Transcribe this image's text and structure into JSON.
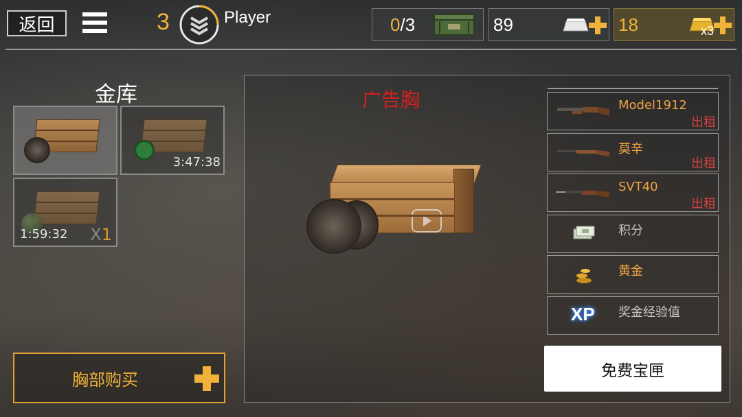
{
  "header": {
    "back_label": "返回",
    "level": "3",
    "player_name": "Player",
    "crates_count_current": "0",
    "crates_count_total": "/3",
    "silver": "89",
    "gold": "18",
    "gold_multiplier": "x3"
  },
  "vault": {
    "title": "金库",
    "slots": [
      {
        "timer": ""
      },
      {
        "timer": "3:47:38"
      },
      {
        "timer": "1:59:32",
        "count_prefix": "X",
        "count": "1"
      }
    ],
    "buy_label": "胸部购买"
  },
  "chest": {
    "name": "广告胸",
    "rewards": [
      {
        "label": "Model1912",
        "tag": "出租",
        "icon": "shotgun-icon"
      },
      {
        "label": "莫辛",
        "tag": "出租",
        "icon": "rifle-icon"
      },
      {
        "label": "SVT40",
        "tag": "出租",
        "icon": "rifle-bayonet-icon"
      },
      {
        "label": "积分",
        "icon": "cash-stack-icon"
      },
      {
        "label": "黄金",
        "icon": "gold-coins-icon"
      },
      {
        "label": "奖金经验值",
        "icon": "xp-icon",
        "icon_text": "XP"
      }
    ],
    "free_button_label": "免费宝匣"
  },
  "colors": {
    "accent_orange": "#f0b23a",
    "chest_name_red": "#d42020",
    "rent_red": "#d24343"
  }
}
